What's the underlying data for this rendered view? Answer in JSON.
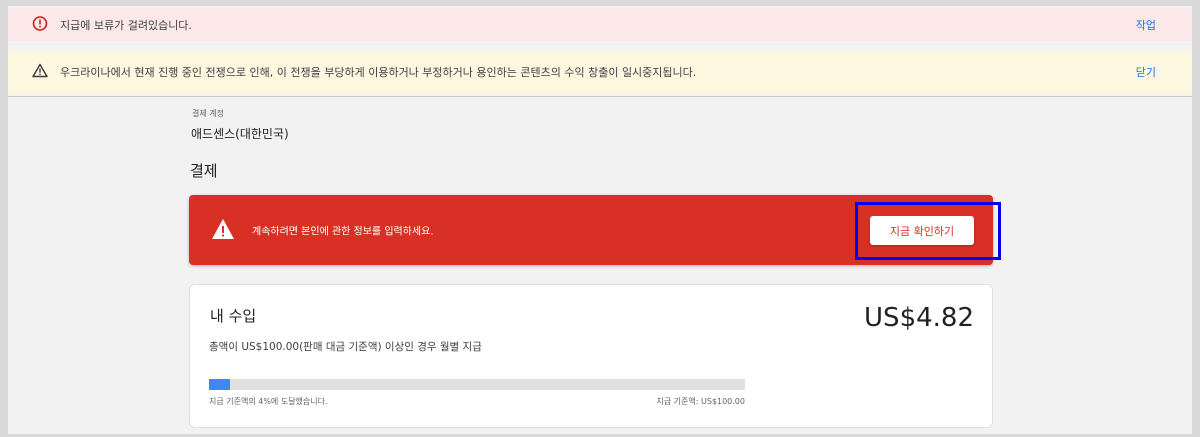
{
  "banners": {
    "payment_hold": {
      "icon": "error-circle-icon",
      "message": "지급에 보류가 걸려있습니다.",
      "action": "작업"
    },
    "ukraine_notice": {
      "icon": "warning-triangle-icon",
      "message": "우크라이나에서 현재 진행 중인 전쟁으로 인해, 이 전쟁을 부당하게 이용하거나 부정하거나 용인하는 콘텐츠의 수익 창출이 일시중지됩니다.",
      "action": "닫기"
    }
  },
  "account": {
    "label": "결제 계정",
    "name": "애드센스(대한민국)"
  },
  "section_title": "결제",
  "alert": {
    "icon": "warning-triangle-icon",
    "message": "계속하려면 본인에 관한 정보를 입력하세요.",
    "button": "지금 확인하기",
    "color": "#d93025"
  },
  "earnings": {
    "title": "내 수입",
    "amount": "US$4.82",
    "description": "총액이 US$100.00(판매 대금 기준액) 이상인 경우 월별 지급",
    "progress_fraction": 0.04,
    "progress_left": "지급 기준액의 4%에 도달했습니다.",
    "progress_right": "지급 기준액: US$100.00"
  }
}
